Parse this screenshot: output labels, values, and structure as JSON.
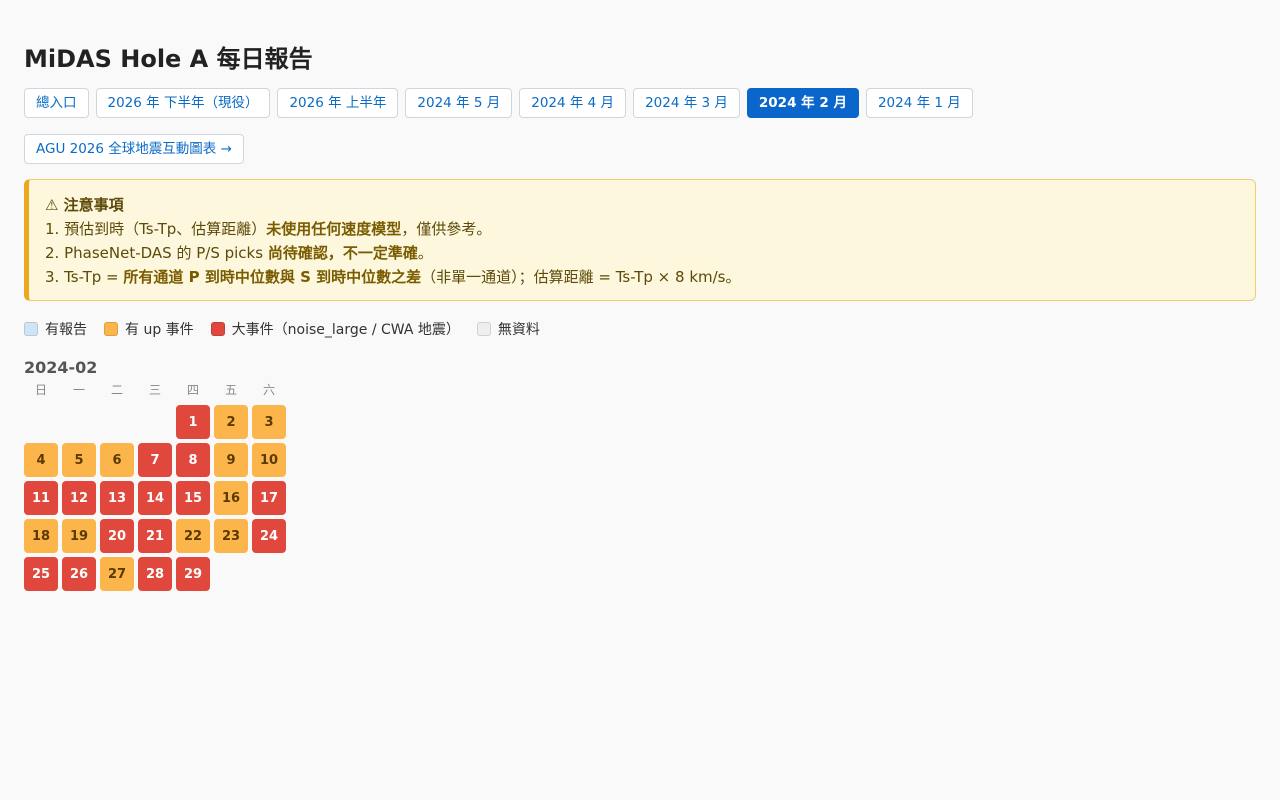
{
  "page_title": "MiDAS Hole A 每日報告",
  "nav": {
    "links": [
      {
        "label": "總入口",
        "active": false
      },
      {
        "label": "2026 年 下半年（現役）",
        "active": false
      },
      {
        "label": "2026 年 上半年",
        "active": false
      },
      {
        "label": "2024 年 5 月",
        "active": false
      },
      {
        "label": "2024 年 4 月",
        "active": false
      },
      {
        "label": "2024 年 3 月",
        "active": false
      },
      {
        "label": "2024 年 2 月",
        "active": true
      },
      {
        "label": "2024 年 1 月",
        "active": false
      }
    ],
    "agu_link": "AGU 2026 全球地震互動圖表 →"
  },
  "notice": {
    "icon": "warning-icon",
    "title": "⚠ 注意事項",
    "items": [
      {
        "prefix": "1. 預估到時（Ts-Tp、估算距離）",
        "bold": "未使用任何速度模型",
        "suffix": "，僅供參考。"
      },
      {
        "prefix": "2. PhaseNet-DAS 的 P/S picks ",
        "bold": "尚待確認，不一定準確",
        "suffix": "。"
      },
      {
        "prefix": "3. Ts-Tp = ",
        "bold": "所有通道 P 到時中位數與 S 到時中位數之差",
        "suffix": "（非單一通道）；估算距離 = Ts-Tp × 8 km/s。"
      }
    ]
  },
  "legend": [
    {
      "label": "有報告",
      "color": "#cfe4f5"
    },
    {
      "label": "有 up 事件",
      "color": "#fbb54a"
    },
    {
      "label": "大事件（noise_large / CWA 地震）",
      "color": "#e0483e"
    },
    {
      "label": "無資料",
      "color": "#eeeeee"
    }
  ],
  "calendar": {
    "month": "2024-02",
    "weekdays": [
      "日",
      "一",
      "二",
      "三",
      "四",
      "五",
      "六"
    ],
    "leading_blanks": 4,
    "days": [
      {
        "day": "1",
        "status": "big"
      },
      {
        "day": "2",
        "status": "up"
      },
      {
        "day": "3",
        "status": "up"
      },
      {
        "day": "4",
        "status": "up"
      },
      {
        "day": "5",
        "status": "up"
      },
      {
        "day": "6",
        "status": "up"
      },
      {
        "day": "7",
        "status": "big"
      },
      {
        "day": "8",
        "status": "big"
      },
      {
        "day": "9",
        "status": "up"
      },
      {
        "day": "10",
        "status": "up"
      },
      {
        "day": "11",
        "status": "big"
      },
      {
        "day": "12",
        "status": "big"
      },
      {
        "day": "13",
        "status": "big"
      },
      {
        "day": "14",
        "status": "big"
      },
      {
        "day": "15",
        "status": "big"
      },
      {
        "day": "16",
        "status": "up"
      },
      {
        "day": "17",
        "status": "big"
      },
      {
        "day": "18",
        "status": "up"
      },
      {
        "day": "19",
        "status": "up"
      },
      {
        "day": "20",
        "status": "big"
      },
      {
        "day": "21",
        "status": "big"
      },
      {
        "day": "22",
        "status": "up"
      },
      {
        "day": "23",
        "status": "up"
      },
      {
        "day": "24",
        "status": "big"
      },
      {
        "day": "25",
        "status": "big"
      },
      {
        "day": "26",
        "status": "big"
      },
      {
        "day": "27",
        "status": "up"
      },
      {
        "day": "28",
        "status": "big"
      },
      {
        "day": "29",
        "status": "big"
      }
    ]
  }
}
